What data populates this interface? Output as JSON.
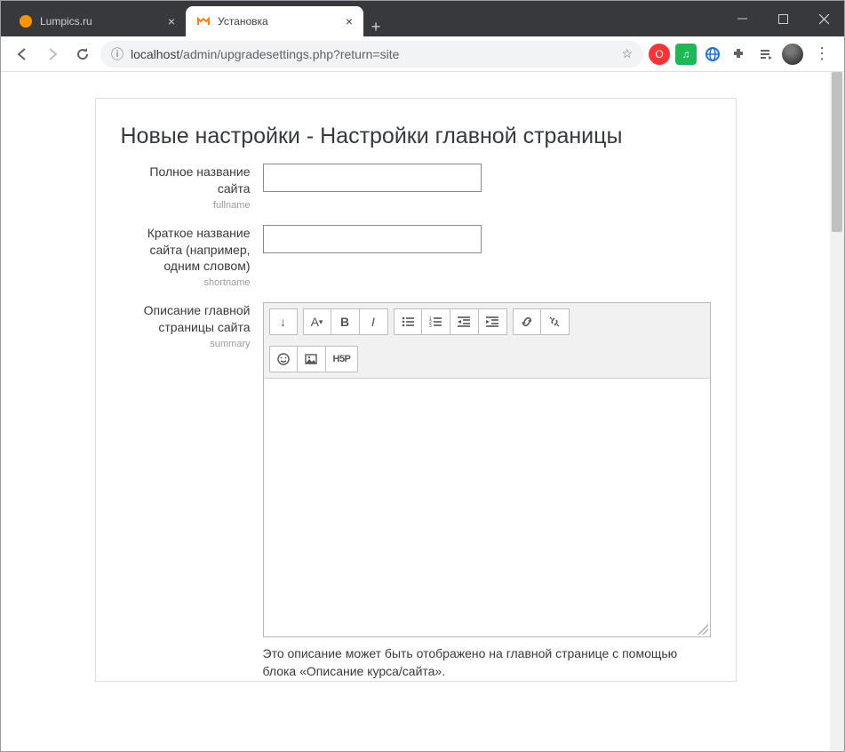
{
  "window": {
    "tabs": [
      {
        "title": "Lumpics.ru",
        "active": false
      },
      {
        "title": "Установка",
        "active": true
      }
    ]
  },
  "address": {
    "info_icon": "ⓘ",
    "url_prefix": "localhost",
    "url_path": "/admin/upgradesettings.php?return=site"
  },
  "page": {
    "heading": "Новые настройки - Настройки главной страницы",
    "fields": {
      "fullname": {
        "label": "Полное название сайта",
        "hint": "fullname",
        "value": ""
      },
      "shortname": {
        "label": "Краткое название сайта (например, одним словом)",
        "hint": "shortname",
        "value": ""
      },
      "summary": {
        "label": "Описание главной страницы сайта",
        "hint": "summary",
        "value": ""
      }
    },
    "description": "Это описание может быть отображено на главной странице с помощью блока «Описание курса/сайта»."
  },
  "editor_buttons": {
    "toggle": "↓",
    "paragraph": "A",
    "bold": "B",
    "italic": "I",
    "h5p": "H5P"
  }
}
